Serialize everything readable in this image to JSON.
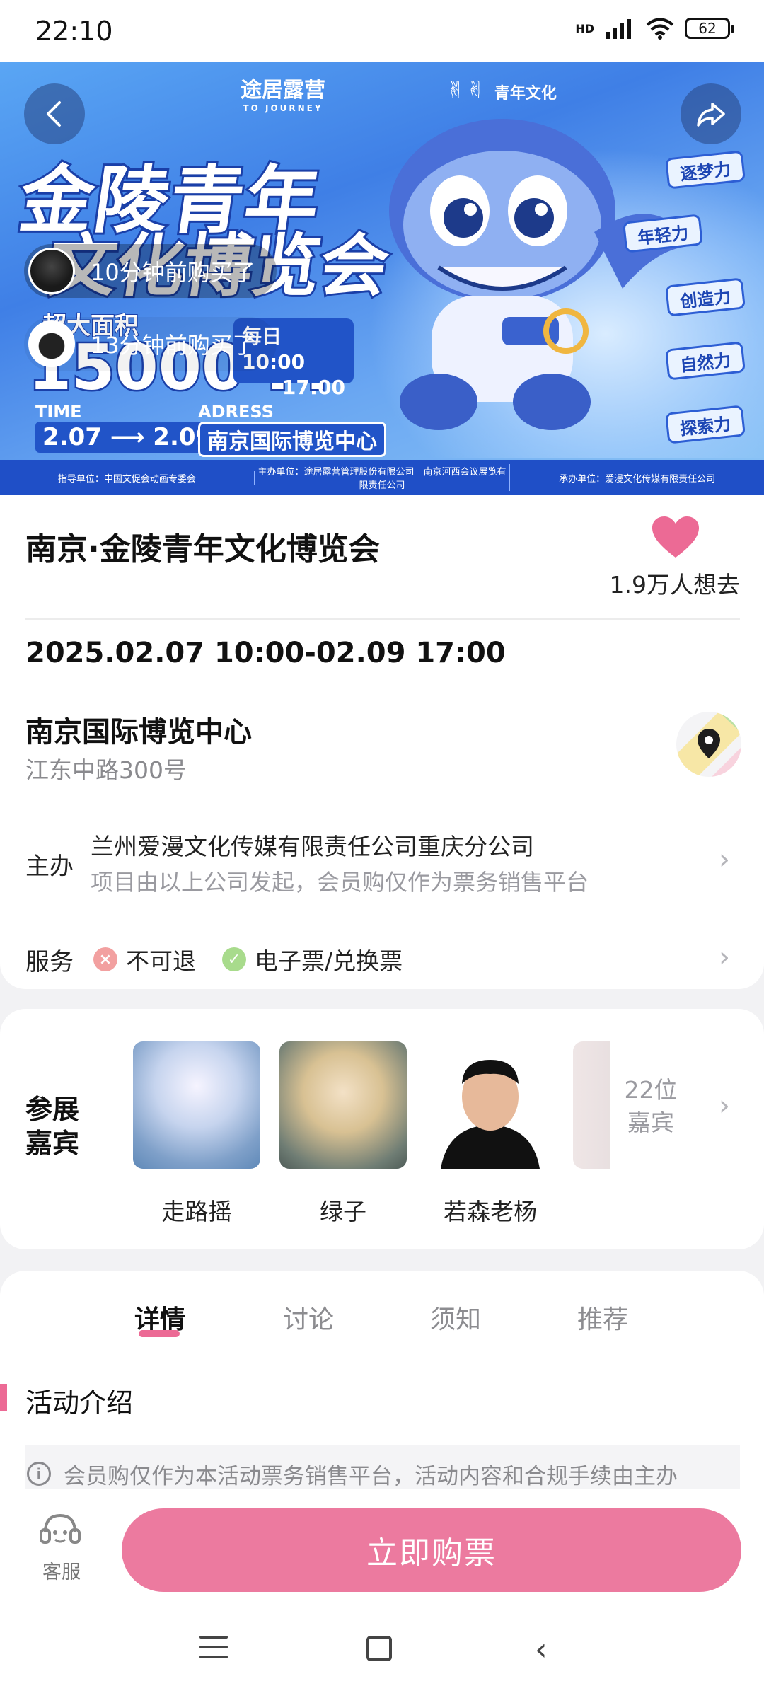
{
  "status_bar": {
    "time": "22:10",
    "network": "HD",
    "battery": "62"
  },
  "banner": {
    "brand": "途居露营",
    "brand_sub": "TO JOURNEY",
    "partner": "青年文化",
    "title_line1": "金陵青年",
    "title_line2": "文化博览会",
    "area_label": "超大面积",
    "area_value": "15000 M",
    "area_unit": "2",
    "hours_line1": "每日 10:00",
    "hours_line2": "17:00",
    "time_label": "TIME",
    "time_value": "2.07 ⟶ 2.09",
    "address_label": "ADRESS",
    "address_value": "南京国际博览中心",
    "tags": [
      "逐梦力",
      "年轻力",
      "创造力",
      "自然力",
      "探索力"
    ],
    "sponsors": [
      "指导单位：中国文促会动画专委会",
      "主办单位：途居露营管理股份有限公司　南京河西会议展览有限责任公司",
      "承办单位：爱漫文化传媒有限责任公司"
    ],
    "buyers": [
      {
        "text": "10分钟前购买了"
      },
      {
        "text": "13分钟前购买了"
      }
    ]
  },
  "event": {
    "title": "南京·金陵青年文化博览会",
    "want_count": "1.9万人想去",
    "datetime": "2025.02.07 10:00-02.09 17:00",
    "venue_name": "南京国际博览中心",
    "venue_address": "江东中路300号",
    "organizer_label": "主办",
    "organizer_name": "兰州爱漫文化传媒有限责任公司重庆分公司",
    "organizer_note": "项目由以上公司发起，会员购仅作为票务销售平台",
    "service_label": "服务",
    "services": [
      {
        "label": "不可退",
        "color": "#f2a0a0",
        "icon": "close-icon"
      },
      {
        "label": "电子票/兑换票",
        "color": "#a8db8c",
        "icon": "check-icon"
      }
    ]
  },
  "guests": {
    "label": "参展嘉宾",
    "items": [
      {
        "name": "走路摇"
      },
      {
        "name": "绿子"
      },
      {
        "name": "若森老杨"
      }
    ],
    "count": "22位嘉宾"
  },
  "tabs": [
    {
      "label": "详情"
    },
    {
      "label": "讨论"
    },
    {
      "label": "须知"
    },
    {
      "label": "推荐"
    }
  ],
  "detail": {
    "section_title": "活动介绍",
    "notice": "会员购仅作为本活动票务销售平台，活动内容和合规手续由主办"
  },
  "bottom": {
    "customer_service": "客服",
    "buy_label": "立即购票"
  },
  "colors": {
    "accent": "#ec7a9f",
    "heart": "#ec6a95"
  }
}
